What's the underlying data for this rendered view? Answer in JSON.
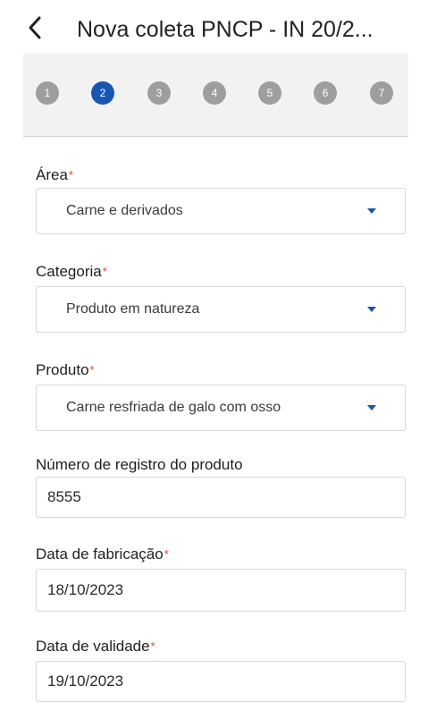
{
  "header": {
    "title": "Nova coleta PNCP - IN 20/2..."
  },
  "stepper": {
    "steps": [
      "1",
      "2",
      "3",
      "4",
      "5",
      "6",
      "7"
    ],
    "active_step": "2"
  },
  "form": {
    "area": {
      "label": "Área",
      "required_mark": "*",
      "value": "Carne e derivados"
    },
    "categoria": {
      "label": "Categoria",
      "required_mark": "*",
      "value": "Produto em natureza"
    },
    "produto": {
      "label": "Produto",
      "required_mark": "*",
      "value": "Carne resfriada de galo com osso"
    },
    "numero_registro": {
      "label": "Número de registro do produto",
      "value": "8555"
    },
    "data_fabricacao": {
      "label": "Data de fabricação",
      "required_mark": "*",
      "value": "18/10/2023"
    },
    "data_validade": {
      "label": "Data de validade",
      "required_mark": "*",
      "value": "19/10/2023"
    }
  },
  "colors": {
    "accent": "#1756b5",
    "inactive_step": "#9e9e9e",
    "required": "#e0433b"
  },
  "icons": {
    "back": "chevron-left-icon",
    "dropdown": "caret-down-icon"
  }
}
